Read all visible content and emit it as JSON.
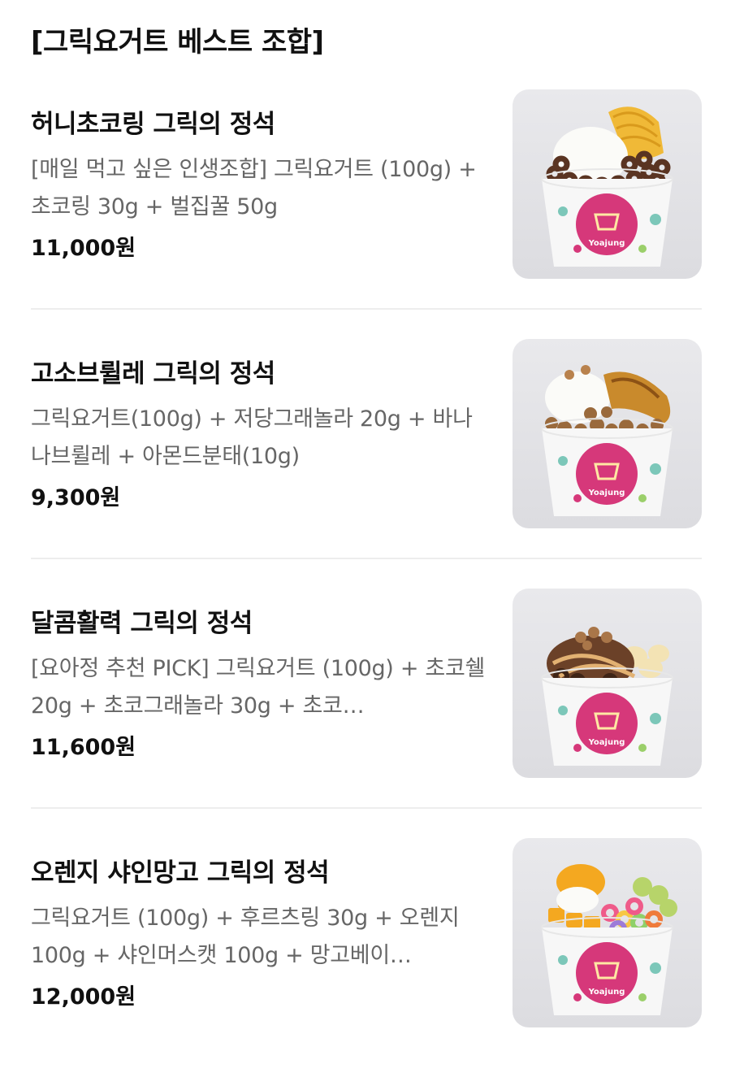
{
  "section": {
    "title": "[그릭요거트 베스트 조합]"
  },
  "colors": {
    "cup_logo": "#d6387a",
    "background": "#ffffff",
    "name_text": "#111111",
    "desc_text": "#666666",
    "divider": "#ededed"
  },
  "items": [
    {
      "name": "허니초코링 그릭의 정석",
      "description": "[매일 먹고 싶은 인생조합] 그릭요거트 (100g) + 초코링 30g + 벌집꿀 50g",
      "price": "11,000원",
      "cup_brand": "Yoajung",
      "image_icon": "honey-choco-ring-yogurt-bowl-icon"
    },
    {
      "name": "고소브륄레 그릭의 정석",
      "description": "그릭요거트(100g) + 저당그래놀라 20g + 바나나브륄레 + 아몬드분태(10g)",
      "price": "9,300원",
      "cup_brand": "Yoajung",
      "image_icon": "granola-banana-yogurt-bowl-icon"
    },
    {
      "name": "달콤활력 그릭의 정석",
      "description": "[요아정 추천 PICK] 그릭요거트 (100g) + 초코쉘 20g + 초코그래놀라 30g + 초코…",
      "price": "11,600원",
      "cup_brand": "Yoajung",
      "image_icon": "choco-granola-yogurt-bowl-icon"
    },
    {
      "name": "오렌지 샤인망고 그릭의 정석",
      "description": "그릭요거트 (100g) + 후르츠링 30g + 오렌지 100g + 샤인머스캣 100g + 망고베이…",
      "price": "12,000원",
      "cup_brand": "Yoajung",
      "image_icon": "mango-fruit-ring-yogurt-bowl-icon"
    }
  ]
}
